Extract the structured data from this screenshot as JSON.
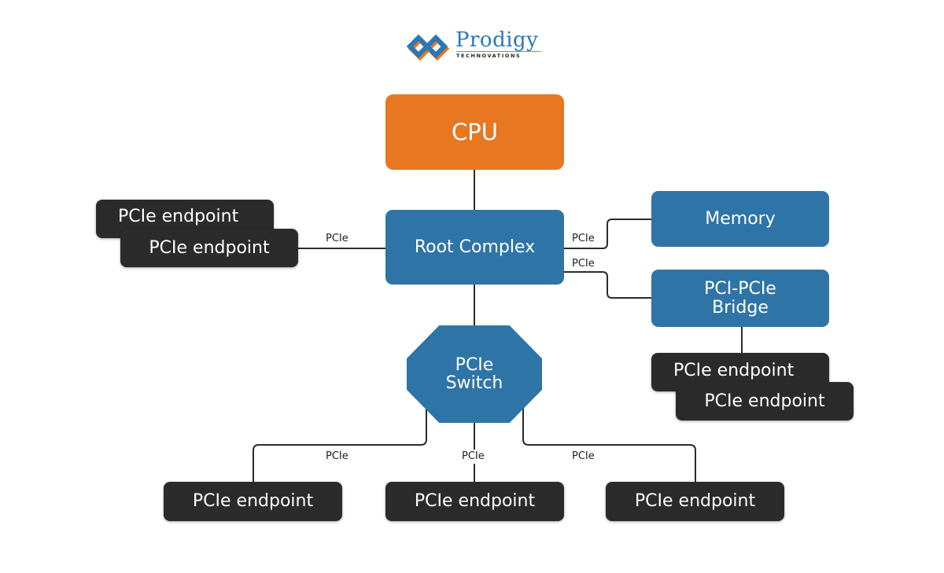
{
  "logo": {
    "name": "Prodigy",
    "tagline": "TECHNOVATIONS",
    "colors": {
      "blue": "#2a78b5",
      "orange": "#e87722"
    }
  },
  "nodes": {
    "cpu": "CPU",
    "root_complex": "Root Complex",
    "memory": "Memory",
    "bridge": "PCI-PCIe Bridge",
    "switch_line1": "PCIe",
    "switch_line2": "Switch",
    "endpoint": "PCIe endpoint"
  },
  "endpoints": {
    "left_back": "PCIe endpoint",
    "left_front": "PCIe endpoint",
    "bridge_back": "PCIe endpoint",
    "bridge_front": "PCIe endpoint",
    "bottom_left": "PCIe endpoint",
    "bottom_center": "PCIe endpoint",
    "bottom_right": "PCIe endpoint"
  },
  "links": {
    "left": "PCIe",
    "memory": "PCIe",
    "bridge": "PCIe",
    "switch_left": "PCIe",
    "switch_center": "PCIe",
    "switch_right": "PCIe"
  },
  "colors": {
    "cpu": "#e87722",
    "component": "#2f74a6",
    "endpoint": "#2b2b2b",
    "wire": "#2b2b2b"
  }
}
